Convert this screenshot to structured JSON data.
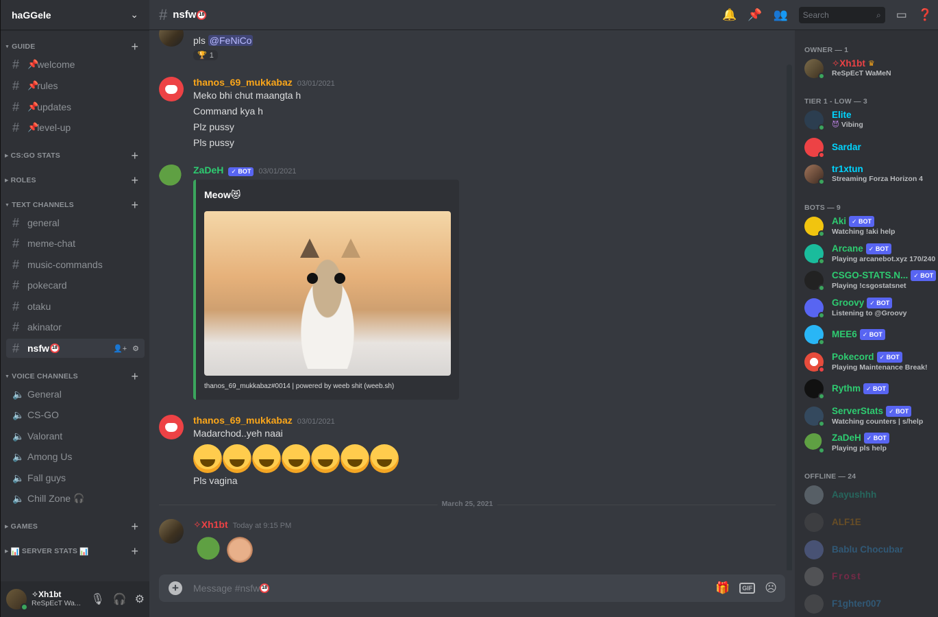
{
  "server": {
    "name": "haGGele"
  },
  "categories": {
    "guide": "GUIDE",
    "csgo": "CS:GO STATS",
    "roles": "ROLES",
    "text": "TEXT CHANNELS",
    "voice": "VOICE CHANNELS",
    "games": "GAMES",
    "server_stats": "SERVER STATS"
  },
  "guide_channels": [
    "welcome",
    "rules",
    "updates",
    "level-up"
  ],
  "text_channels": [
    "general",
    "meme-chat",
    "music-commands",
    "pokecard",
    "otaku",
    "akinator",
    "nsfw"
  ],
  "voice_channels": [
    "General",
    "CS-GO",
    "Valorant",
    "Among Us",
    "Fall guys",
    "Chill Zone"
  ],
  "user_panel": {
    "name": "✧Xh1bt",
    "status": "ReSpEcT Wa..."
  },
  "topbar": {
    "channel": "nsfw",
    "search_placeholder": "Search"
  },
  "messages": {
    "m0": {
      "text_prefix": "pls ",
      "mention": "@FeNiCo",
      "reaction_count": "1"
    },
    "m1": {
      "author": "thanos_69_mukkabaz",
      "time": "03/01/2021",
      "lines": [
        "Meko bhi chut maangta h",
        "Command kya h",
        "Plz pussy",
        "Pls pussy"
      ]
    },
    "m2": {
      "author": "ZaDeH",
      "bot": "✓ BOT",
      "time": "03/01/2021",
      "embed_title": "Meow",
      "embed_footer": "thanos_69_mukkabaz#0014 | powered by weeb shit (weeb.sh)"
    },
    "m3": {
      "author": "thanos_69_mukkabaz",
      "time": "03/01/2021",
      "line1": "Madarchod..yeh naai",
      "line2": "Pls vagina"
    },
    "divider": "March 25, 2021",
    "m4": {
      "author": "✧Xh1bt",
      "time": "Today at 9:15 PM"
    }
  },
  "composer": {
    "placeholder": "Message #nsfw"
  },
  "members": {
    "owner_header": "OWNER — 1",
    "owner": {
      "name": "✧Xh1bt",
      "status": "ReSpEcT WaMeN"
    },
    "tier_header": "TIER 1 - LOW — 3",
    "tier": [
      {
        "name": "Elite",
        "status": "Vibing"
      },
      {
        "name": "Sardar",
        "status": ""
      },
      {
        "name": "tr1xtun",
        "status": "Streaming Forza Horizon 4"
      }
    ],
    "bots_header": "BOTS — 9",
    "bots": [
      {
        "name": "Aki",
        "status": "Watching !aki help"
      },
      {
        "name": "Arcane",
        "status": "Playing arcanebot.xyz 170/240"
      },
      {
        "name": "CSGO-STATS.N...",
        "status": "Playing !csgostatsnet"
      },
      {
        "name": "Groovy",
        "status": "Listening to @Groovy"
      },
      {
        "name": "MEE6",
        "status": ""
      },
      {
        "name": "Pokecord",
        "status": "Playing Maintenance Break!"
      },
      {
        "name": "Rythm",
        "status": ""
      },
      {
        "name": "ServerStats",
        "status": "Watching counters | s/help"
      },
      {
        "name": "ZaDeH",
        "status": "Playing pls help"
      }
    ],
    "bot_tag": "✓ BOT",
    "offline_header": "OFFLINE — 24",
    "offline": [
      "Aayushhh",
      "ALF1E",
      "Bablu Chocubar",
      "Frost",
      "F1ghter007"
    ]
  },
  "colors": {
    "thanos": "#faa61a",
    "zadeh": "#2ecc71",
    "owner": "#ed4245",
    "elite": "#00d5ff",
    "bot_green": "#2ecc71"
  }
}
